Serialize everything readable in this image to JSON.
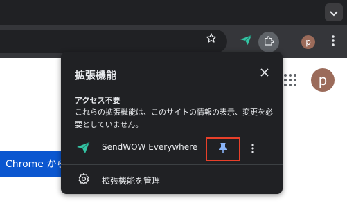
{
  "toolbar": {
    "avatar_initial": "p"
  },
  "page": {
    "avatar_initial": "p",
    "button_text": "Chrome から"
  },
  "popup": {
    "title": "拡張機能",
    "section_heading": "アクセス不要",
    "section_desc": "これらの拡張機能は、このサイトの情報の表示、変更を必要としていません。",
    "extension": {
      "name": "SendWOW Everywhere",
      "icon": "paper-plane-icon",
      "icon_color": "#34c4a4"
    },
    "manage_label": "拡張機能を管理"
  },
  "colors": {
    "highlight_border": "#e8402a",
    "pin_color": "#8ab4f8",
    "page_button": "#0b57d0"
  }
}
